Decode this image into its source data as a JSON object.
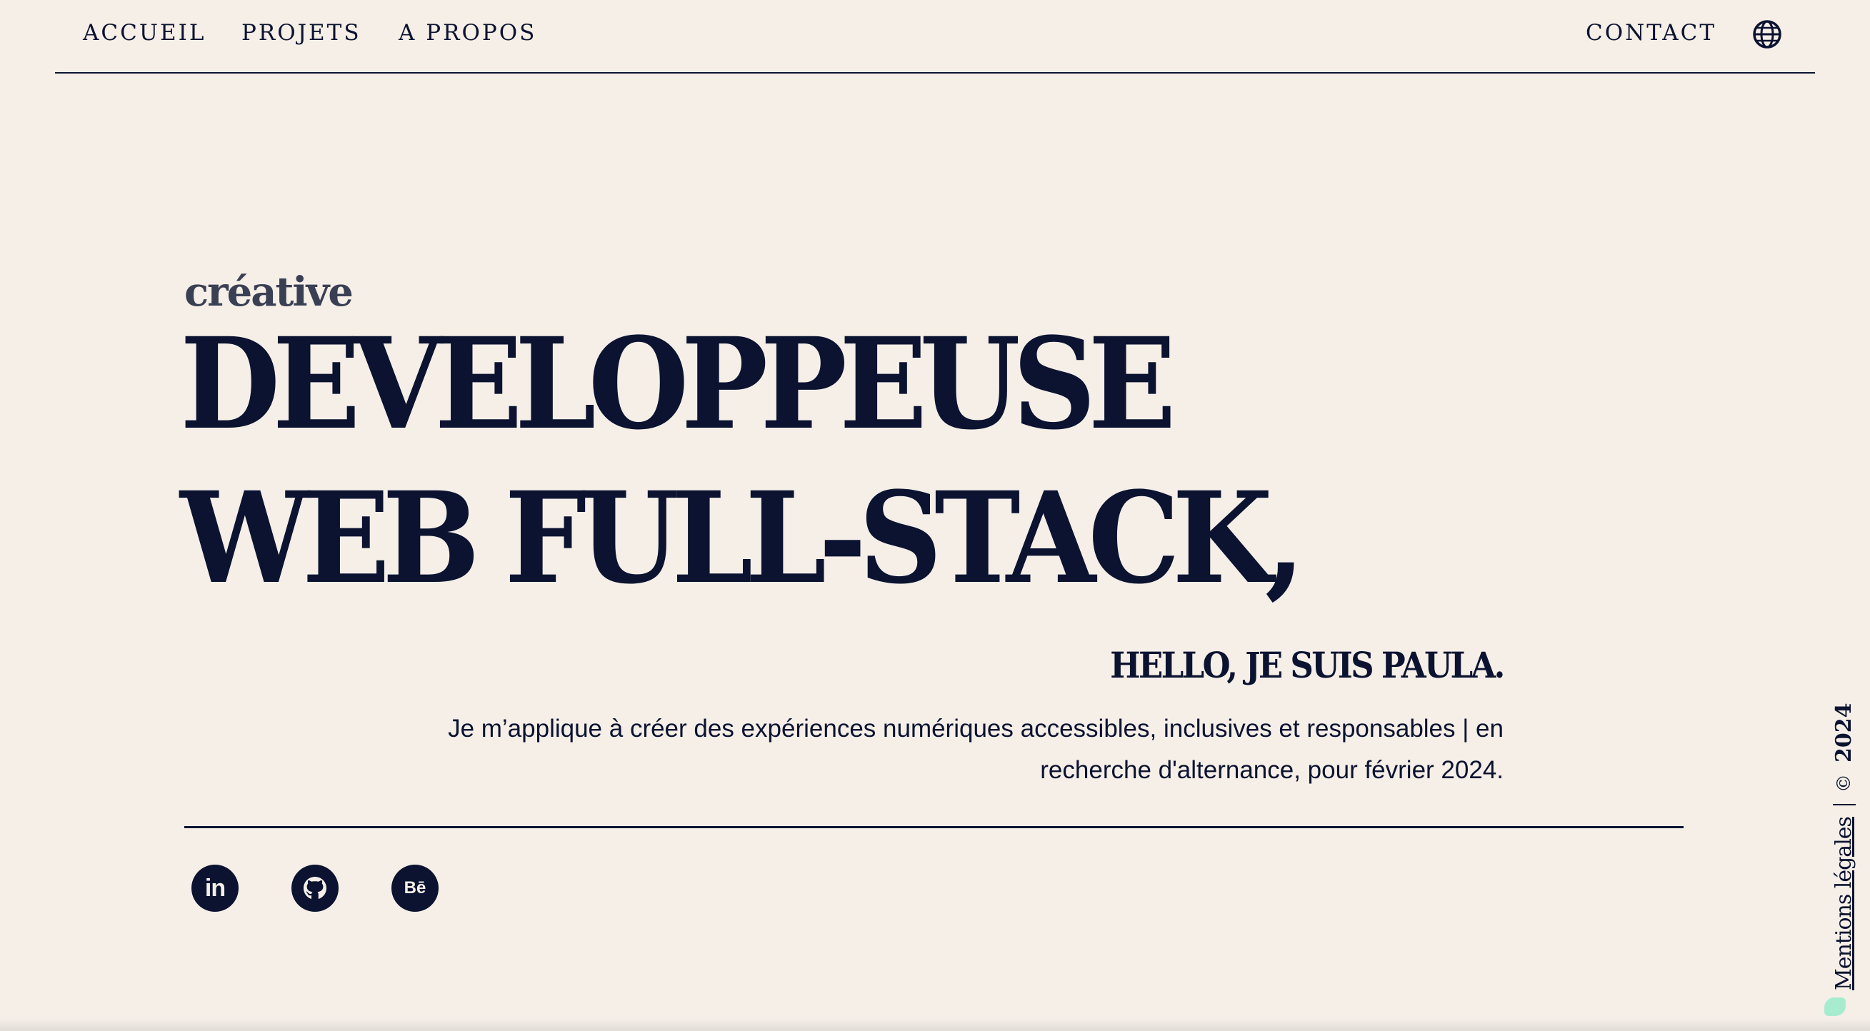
{
  "nav": {
    "home": "ACCUEIL",
    "projects": "PROJETS",
    "about": "A PROPOS",
    "contact": "CONTACT",
    "language_icon": "globe-icon"
  },
  "hero": {
    "eyebrow": "créative",
    "headline_line1": "DEVELOPPEUSE",
    "headline_line2": "WEB FULL-STACK,",
    "greeting": "HELLO, JE SUIS PAULA.",
    "intro": "Je m’applique à créer des expériences numériques accessibles, inclusives et responsables | en recherche d'alternance, pour février 2024."
  },
  "social": {
    "linkedin": {
      "icon": "linkedin-icon",
      "label": "in"
    },
    "github": {
      "icon": "github-icon"
    },
    "behance": {
      "icon": "behance-icon",
      "label": "Bē"
    }
  },
  "footer": {
    "legal": "Mentions légales",
    "copyright_symbol": "©",
    "year": "2024"
  },
  "colors": {
    "background": "#f5efe8",
    "ink": "#0b1330",
    "eyebrow": "#3a4054",
    "accent": "#a8ecd0"
  }
}
